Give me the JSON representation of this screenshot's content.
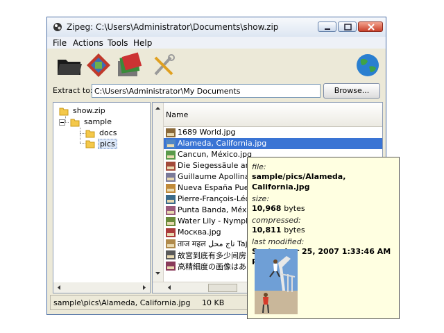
{
  "window": {
    "title": "Zipeg: C:\\Users\\Administrator\\Documents\\show.zip"
  },
  "menu": [
    "File",
    "Actions",
    "Tools",
    "Help"
  ],
  "toolbar": {
    "icons": [
      "open-archive-icon",
      "extract-icon",
      "extract-selected-icon",
      "options-tools-icon",
      "web-globe-icon"
    ]
  },
  "extract": {
    "label": "Extract to:",
    "path": "C:\\Users\\Administrator\\My Documents",
    "browse_label": "Browse..."
  },
  "tree": {
    "root": "show.zip",
    "children": [
      {
        "label": "sample",
        "children": [
          "docs",
          "pics"
        ]
      }
    ],
    "selected": "pics"
  },
  "list": {
    "column_name": "Name",
    "selected_index": 1,
    "files": [
      "1689 World.jpg",
      "Alameda, California.jpg",
      "Cancun, México.jpg",
      "Die Siegessäule am Großer Stern",
      "Guillaume Apollinaire, Hôtel",
      "Nueva España Puerto de",
      "Pierre-François-Léonard",
      "Punta Banda, México.jpg",
      "Water Lily - Nymphaeaceae",
      "Москва.jpg",
      "ताज महल تاج محل Taj Mahal",
      "故宮到底有多少间房 最多",
      "高精細度の画像はありま"
    ]
  },
  "status": {
    "path": "sample\\pics\\Alameda, California.jpg",
    "size": "10 KB"
  },
  "tooltip": {
    "file_label": "file:",
    "file_value": "sample/pics/Alameda, California.jpg",
    "size_label": "size:",
    "size_value": "10,968",
    "size_unit": "bytes",
    "compressed_label": "compressed:",
    "compressed_value": "10,811",
    "compressed_unit": "bytes",
    "modified_label": "last modified:",
    "modified_value": "September 25, 2007 1:33:46 AM PDT"
  },
  "colors": {
    "selection": "#3a74d4",
    "tooltip_bg": "#ffffe1",
    "window_bg": "#ece9d8",
    "folder": "#f4c84a"
  }
}
